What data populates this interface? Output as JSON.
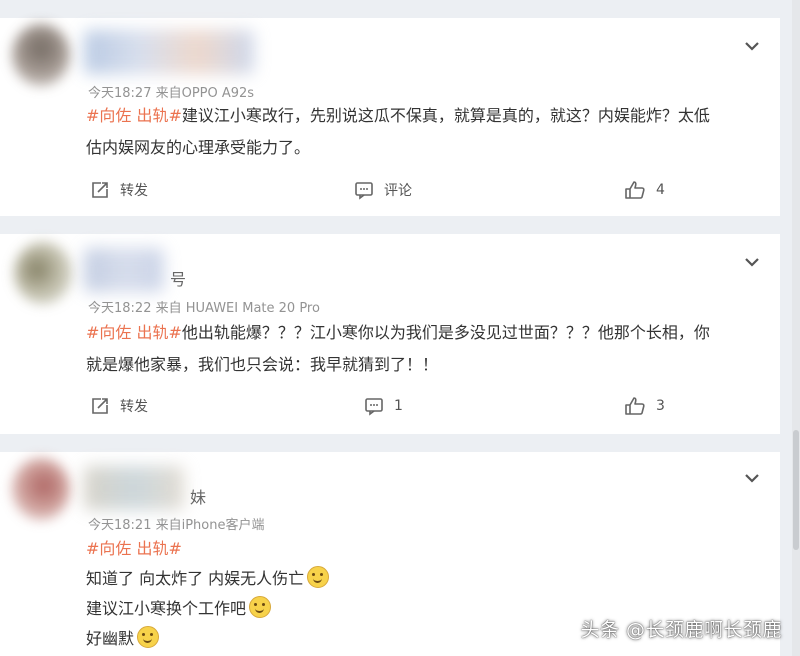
{
  "colors": {
    "tag": "#eb7350",
    "background": "#eceff3",
    "card": "#ffffff"
  },
  "icons": {
    "more": "chevron-down-icon",
    "repost": "repost-icon",
    "comment": "comment-icon",
    "like": "thumbs-up-icon"
  },
  "comments": [
    {
      "meta": "今天18:27 来自OPPO A92s",
      "tag": "#向佐 出轨#",
      "lines": [
        "建议江小寒改行，先别说这瓜不保真，就算是真的，就这？内娱能炸？太低",
        "估内娱网友的心理承受能力了。"
      ],
      "repost_label": "转发",
      "comment_label": "评论",
      "like_count": "4"
    },
    {
      "name_suffix": "号",
      "meta": "今天18:22 来自 HUAWEI Mate 20 Pro",
      "tag": "#向佐 出轨#",
      "lines": [
        "他出轨能爆？？？江小寒你以为我们是多没见过世面？？？他那个长相，你",
        "就是爆他家暴，我们也只会说：我早就猜到了！！"
      ],
      "repost_label": "转发",
      "comment_count": "1",
      "like_count": "3"
    },
    {
      "name_suffix": "妹",
      "meta": "今天18:21 来自iPhone客户端",
      "tag": "#向佐 出轨#",
      "lines": [
        "知道了 向太炸了 内娱无人伤亡",
        "建议江小寒换个工作吧",
        "好幽默"
      ]
    }
  ],
  "watermark": "头条 @长颈鹿啊长颈鹿"
}
